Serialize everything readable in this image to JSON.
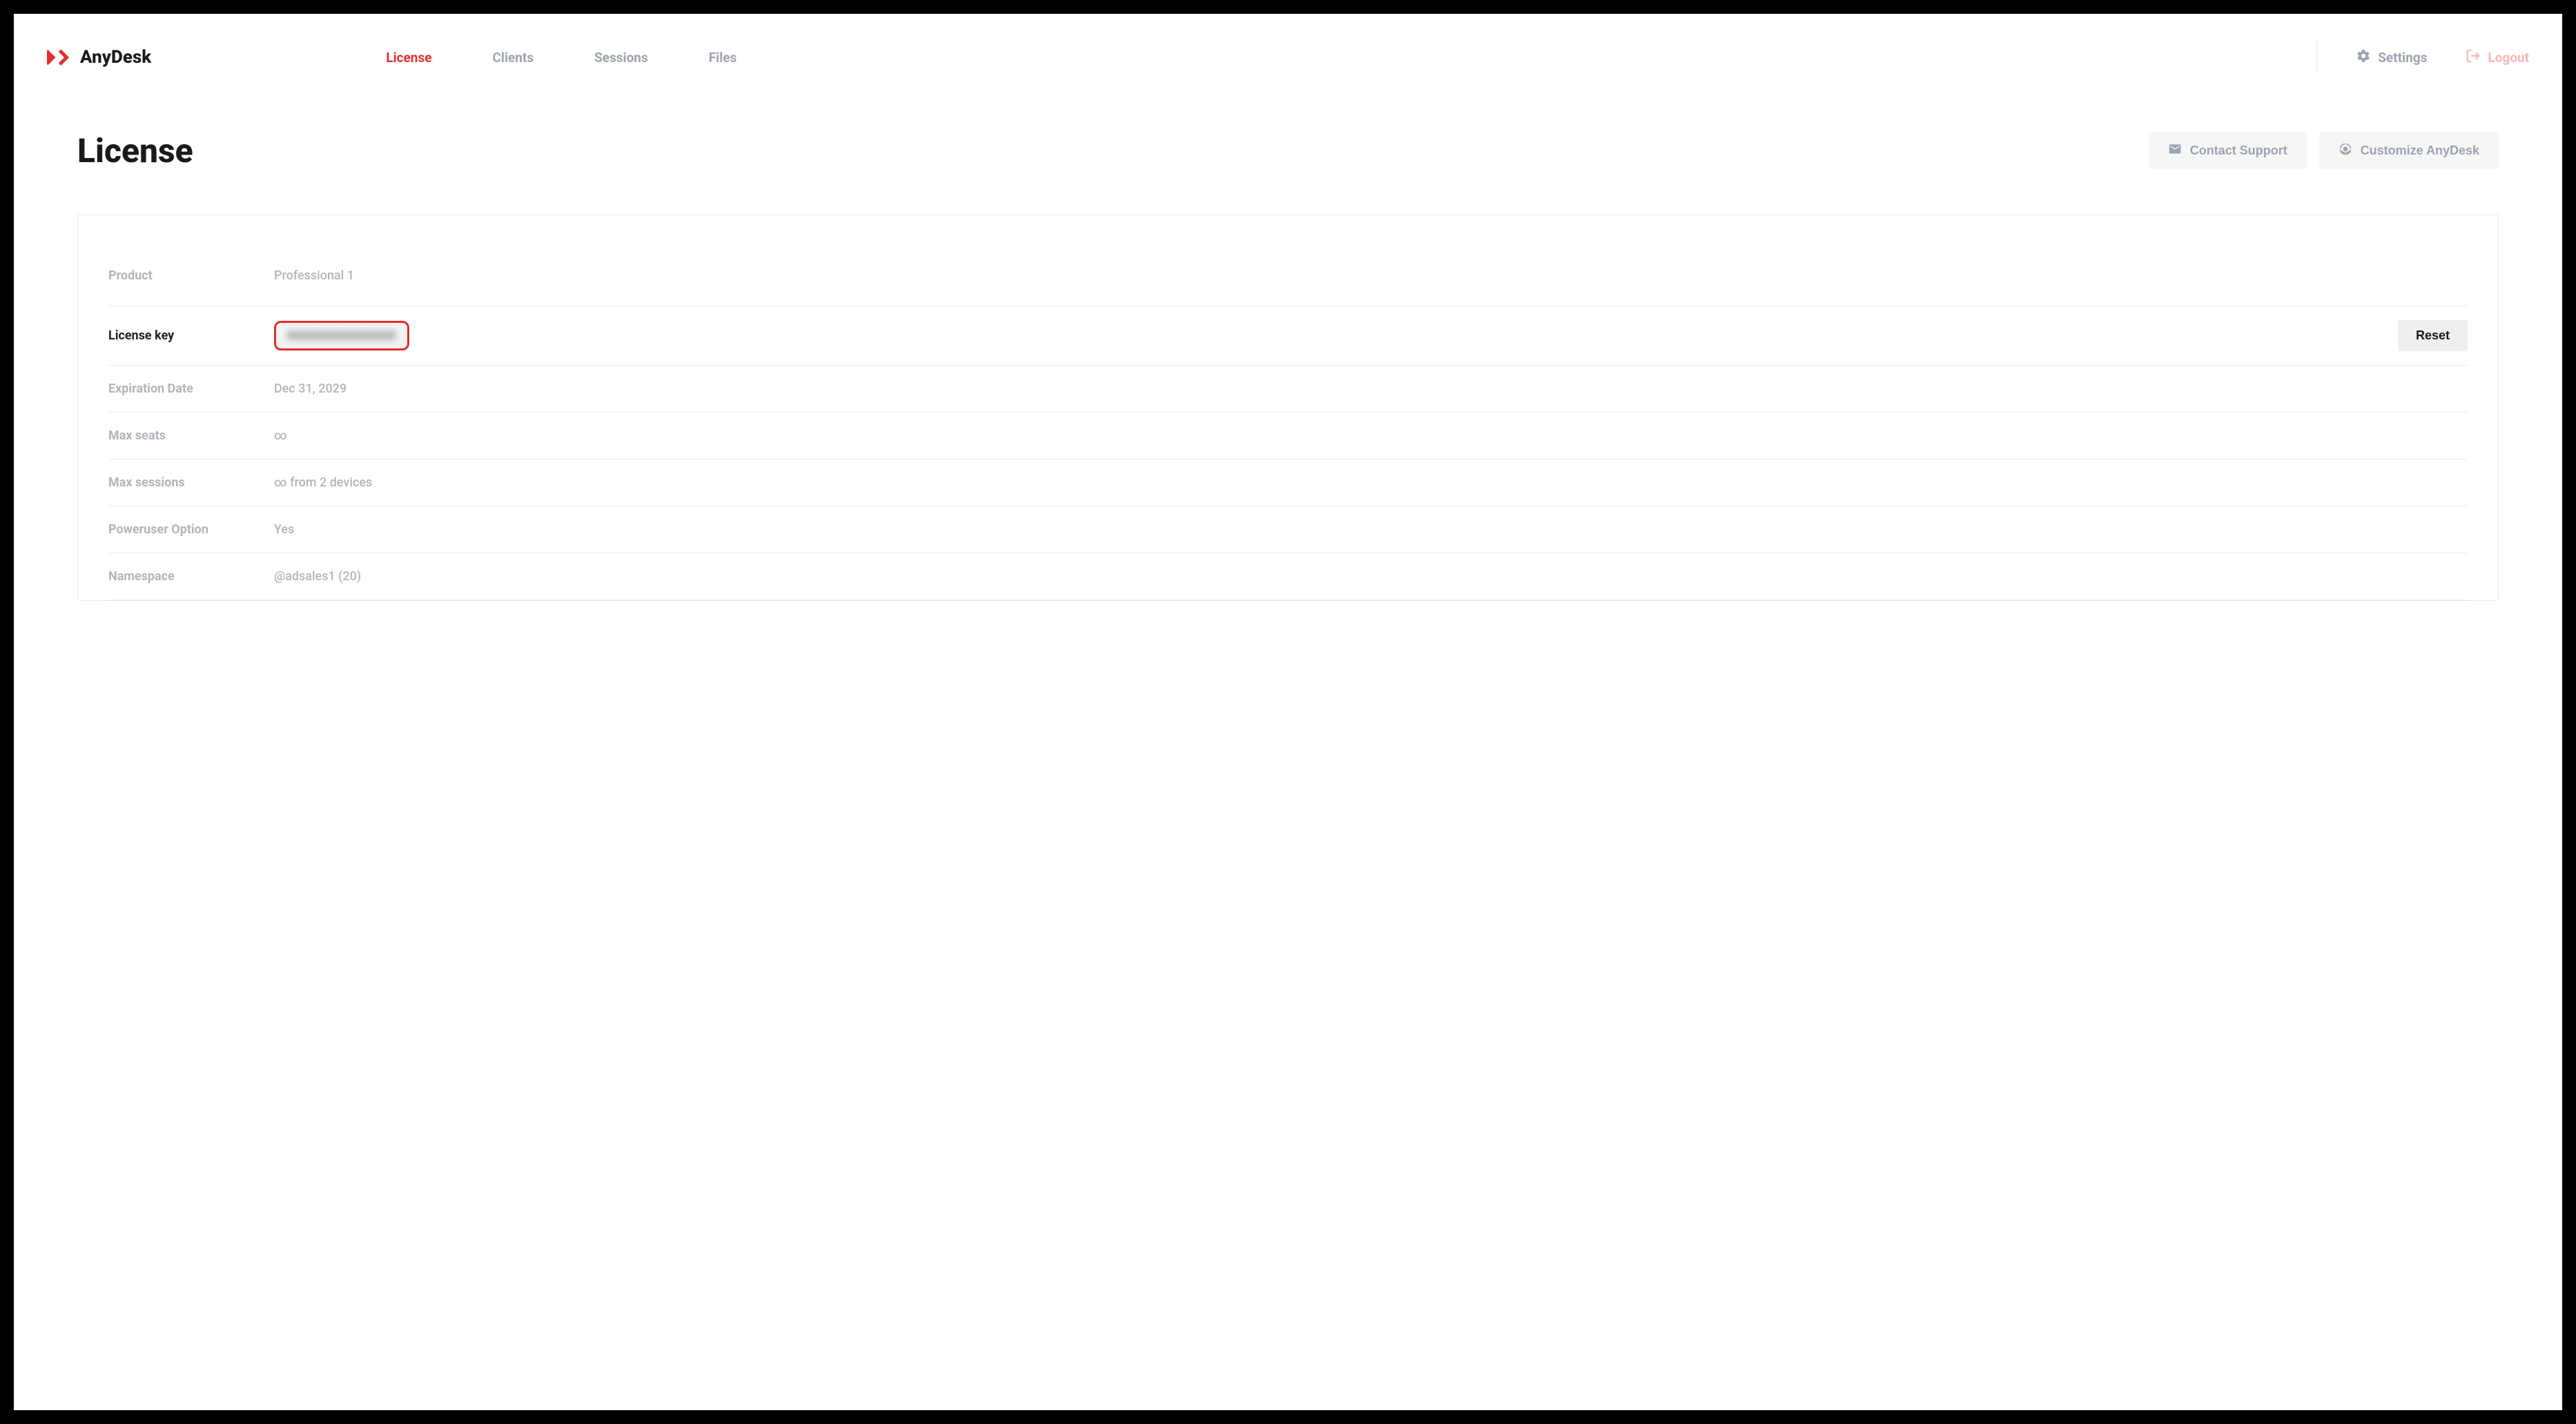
{
  "brand": "AnyDesk",
  "nav": {
    "items": [
      {
        "label": "License",
        "active": true
      },
      {
        "label": "Clients",
        "active": false
      },
      {
        "label": "Sessions",
        "active": false
      },
      {
        "label": "Files",
        "active": false
      }
    ],
    "settings": "Settings",
    "logout": "Logout"
  },
  "page": {
    "title": "License",
    "actions": {
      "contact": "Contact Support",
      "customize": "Customize AnyDesk"
    }
  },
  "license": {
    "rows": {
      "product": {
        "label": "Product",
        "value": "Professional 1"
      },
      "license_key": {
        "label": "License key",
        "value": "XXXXXXXXXXXXXX",
        "reset": "Reset"
      },
      "expiration": {
        "label": "Expiration Date",
        "value": "Dec 31, 2029"
      },
      "max_seats": {
        "label": "Max seats",
        "value": "∞"
      },
      "max_sessions": {
        "label": "Max sessions",
        "value": "∞ from 2 devices"
      },
      "poweruser": {
        "label": "Poweruser Option",
        "value": "Yes"
      },
      "namespace": {
        "label": "Namespace",
        "value": "@adsales1 (20)"
      }
    }
  }
}
